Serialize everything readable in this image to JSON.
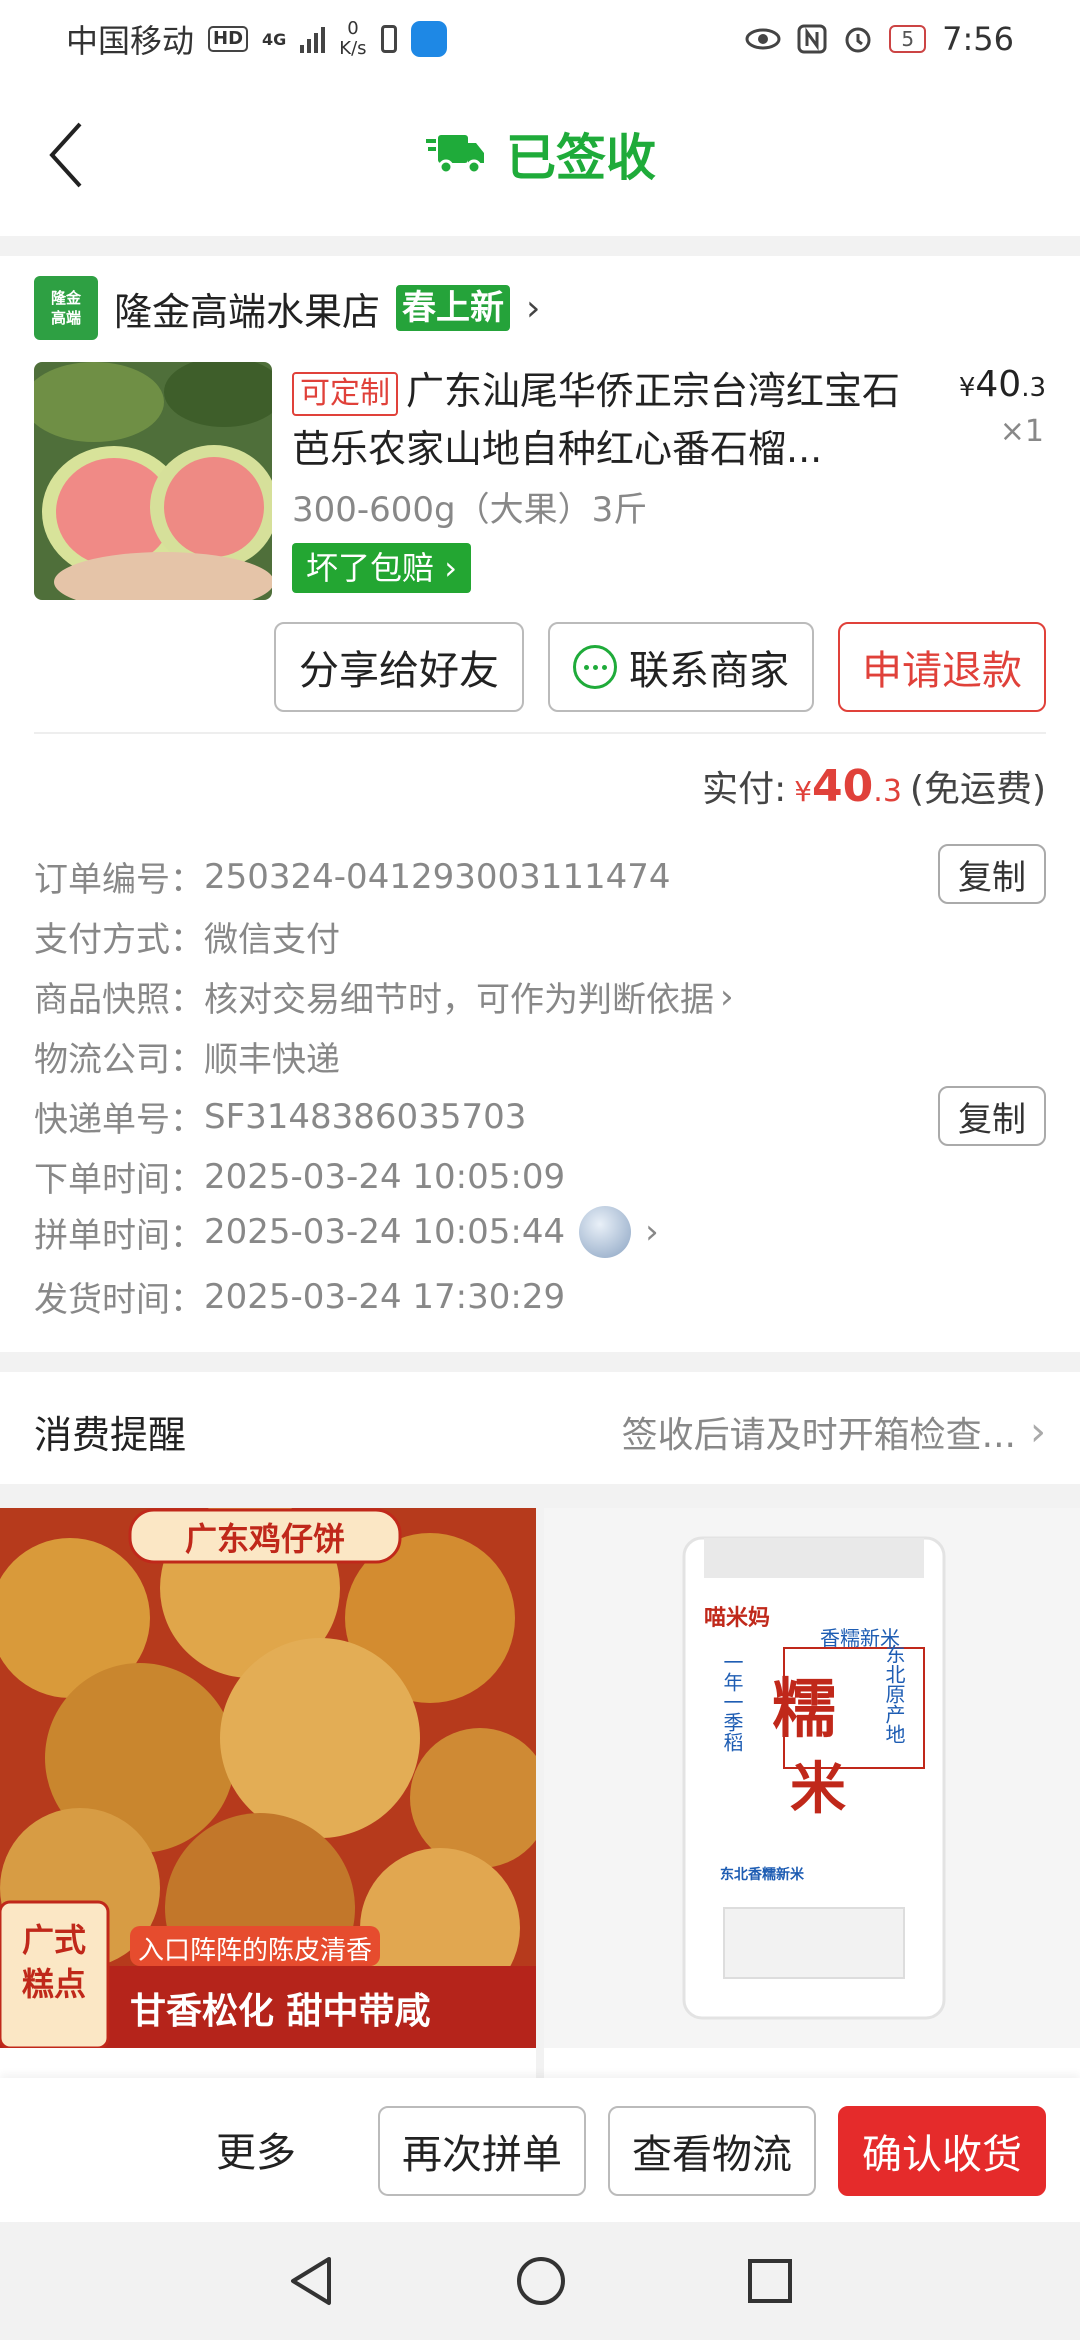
{
  "status_bar": {
    "carrier": "中国移动",
    "hd": "HD",
    "network": "4G",
    "speed_value": "0",
    "speed_unit": "K/s",
    "battery": "5",
    "time": "7:56"
  },
  "header": {
    "title": "已签收"
  },
  "shop": {
    "logo_line1": "隆金",
    "logo_line2": "高端",
    "name": "隆金高端水果店",
    "badge": "春上新"
  },
  "product": {
    "tag": "可定制",
    "title": "广东汕尾华侨正宗台湾红宝石芭乐农家山地自种红心番石榴...",
    "price_symbol": "¥",
    "price_int": "40",
    "price_dec": ".3",
    "quantity": "×1",
    "spec": "300-600g（大果）3斤",
    "guarantee": "坏了包赔"
  },
  "actions": {
    "share": "分享给好友",
    "contact": "联系商家",
    "refund": "申请退款"
  },
  "payment": {
    "label": "实付:",
    "symbol": "¥",
    "amount_int": "40",
    "amount_dec": ".3",
    "note": "(免运费)"
  },
  "order_info": {
    "order_no_label": "订单编号：",
    "order_no": "250324-041293003111474",
    "pay_method_label": "支付方式：",
    "pay_method": "微信支付",
    "snapshot_label": "商品快照：",
    "snapshot": "核对交易细节时，可作为判断依据",
    "logistics_label": "物流公司：",
    "logistics": "顺丰快递",
    "tracking_label": "快递单号：",
    "tracking": "SF3148386035703",
    "order_time_label": "下单时间：",
    "order_time": "2025-03-24 10:05:09",
    "group_time_label": "拼单时间：",
    "group_time": "2025-03-24 10:05:44",
    "ship_time_label": "发货时间：",
    "ship_time": "2025-03-24 17:30:29",
    "copy": "复制"
  },
  "reminder": {
    "title": "消费提醒",
    "value": "签收后请及时开箱检查..."
  },
  "recommend": {
    "left": {
      "banner": "广东鸡仔饼",
      "sub": "入口阵阵的陈皮清香",
      "tagline": "甘香松化  甜中带咸",
      "corner_line1": "广式",
      "corner_line2": "糕点"
    },
    "right": {
      "brand": "喵米妈",
      "label_top": "香糯新米",
      "main1": "糯",
      "main2": "米",
      "vert_left": "一年一季稻",
      "vert_right": "东北原产地",
      "sub": "东北香糯新米"
    }
  },
  "bottom_bar": {
    "more": "更多",
    "regroup": "再次拼单",
    "logistics": "查看物流",
    "confirm": "确认收货"
  },
  "colors": {
    "green": "#1fab3a",
    "red": "#e0413a",
    "confirm_red": "#e52b2b"
  }
}
